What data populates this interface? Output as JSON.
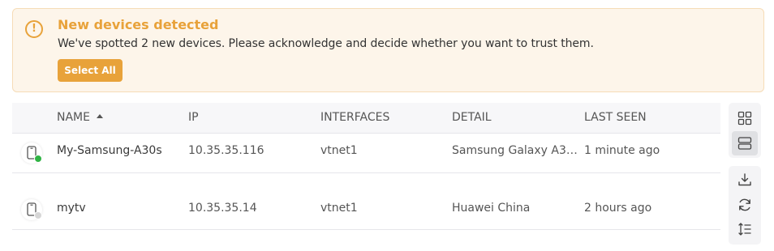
{
  "alert": {
    "icon": "warning-circle-icon",
    "title": "New devices detected",
    "message": "We've spotted 2 new devices. Please acknowledge and decide whether you want to trust them.",
    "button_label": "Select All",
    "accent_color": "#e8a23a"
  },
  "table": {
    "columns": [
      "NAME",
      "IP",
      "INTERFACES",
      "DETAIL",
      "LAST SEEN"
    ],
    "sort_column": "NAME",
    "sort_direction": "ascending",
    "rows": [
      {
        "icon": "mobile-device-icon",
        "status": "online",
        "status_color": "#2fb344",
        "name": "My-Samsung-A30s",
        "ip": "10.35.35.116",
        "interface": "vtnet1",
        "detail": "Samsung Galaxy A3…",
        "last_seen": "1 minute ago"
      },
      {
        "icon": "mobile-device-icon",
        "status": "offline",
        "status_color": "#d6d6d6",
        "name": "mytv",
        "ip": "10.35.35.14",
        "interface": "vtnet1",
        "detail": "Huawei China",
        "last_seen": "2 hours ago"
      }
    ]
  },
  "toolbar": {
    "view_modes": [
      "grid-view-icon",
      "list-view-icon"
    ],
    "active_view": "list-view-icon",
    "actions": [
      "download-icon",
      "refresh-icon",
      "sort-lines-icon"
    ]
  }
}
